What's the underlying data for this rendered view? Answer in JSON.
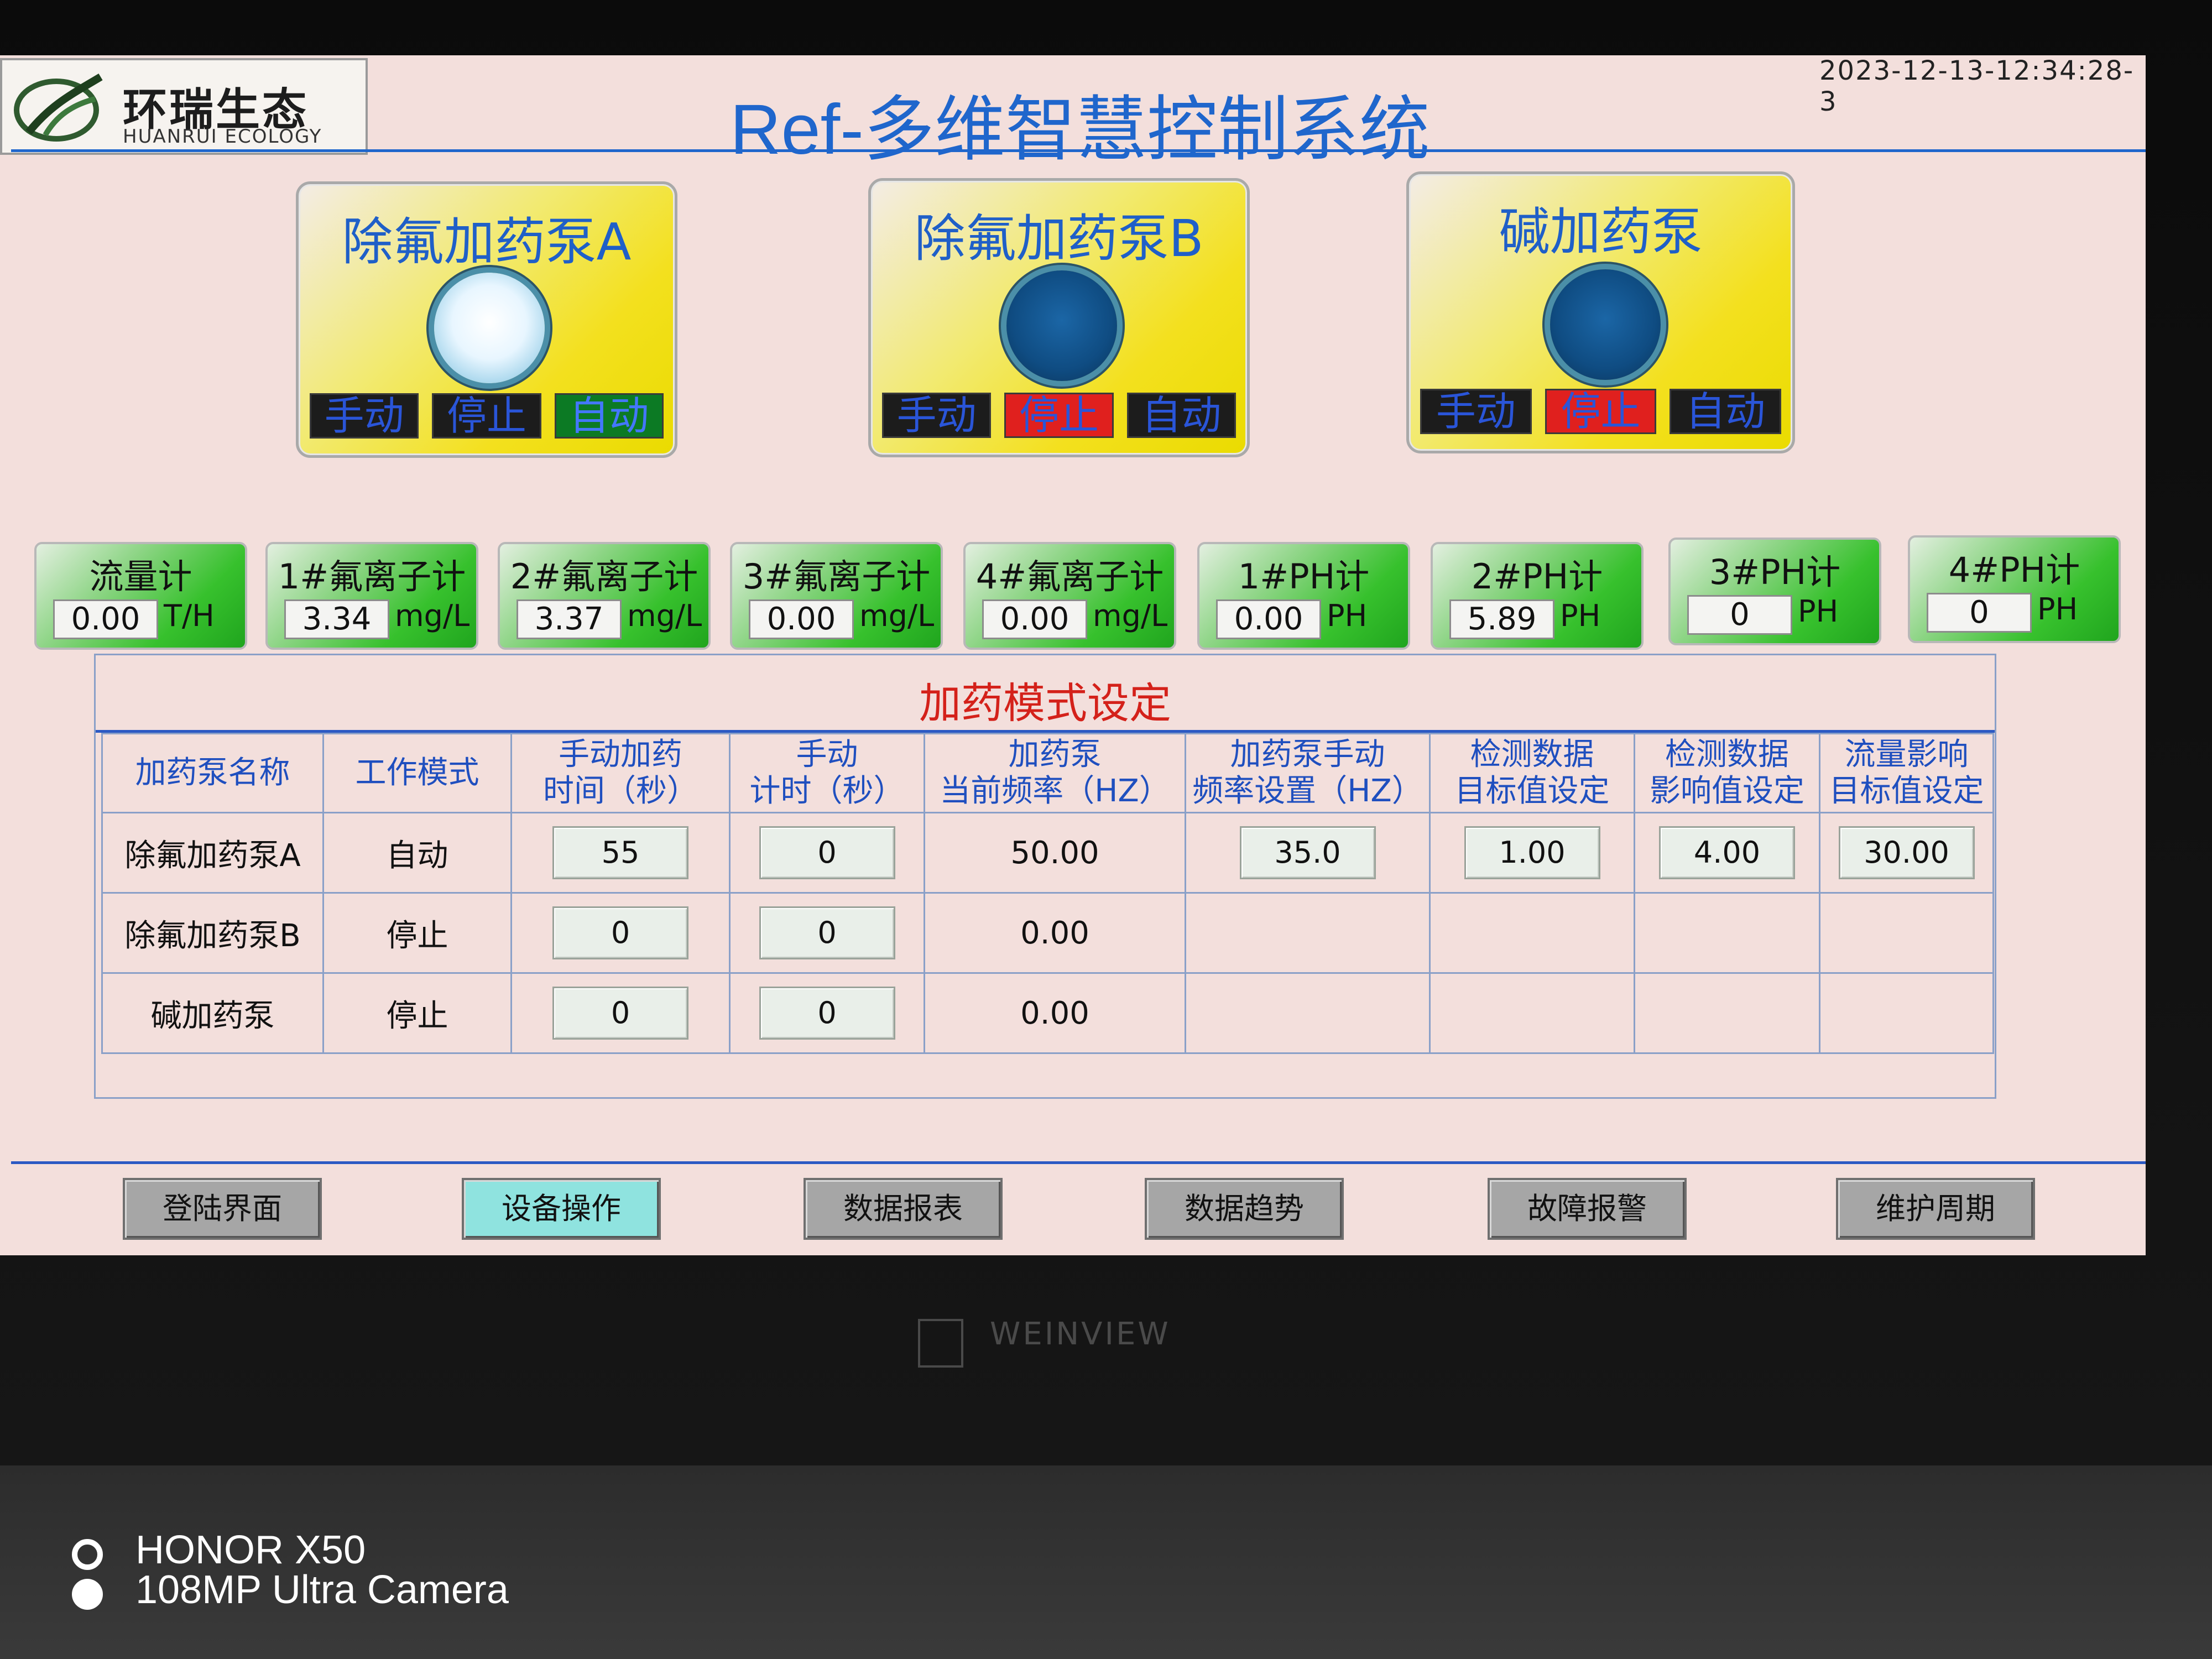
{
  "header": {
    "logo_cn": "环瑞生态",
    "logo_en": "HUANRUI ECOLOGY",
    "title": "Ref-多维智慧控制系统",
    "datetime": "2023-12-13-12:34:28-3"
  },
  "pumps": [
    {
      "title": "除氟加药泵A",
      "lamp": "on",
      "buttons": [
        "手动",
        "停止",
        "自动"
      ],
      "active": "自动"
    },
    {
      "title": "除氟加药泵B",
      "lamp": "off",
      "buttons": [
        "手动",
        "停止",
        "自动"
      ],
      "active": "停止"
    },
    {
      "title": "碱加药泵",
      "lamp": "off",
      "buttons": [
        "手动",
        "停止",
        "自动"
      ],
      "active": "停止"
    }
  ],
  "meters": [
    {
      "name": "流量计",
      "value": "0.00",
      "unit": "T/H"
    },
    {
      "name": "1#氟离子计",
      "value": "3.34",
      "unit": "mg/L"
    },
    {
      "name": "2#氟离子计",
      "value": "3.37",
      "unit": "mg/L"
    },
    {
      "name": "3#氟离子计",
      "value": "0.00",
      "unit": "mg/L"
    },
    {
      "name": "4#氟离子计",
      "value": "0.00",
      "unit": "mg/L"
    },
    {
      "name": "1#PH计",
      "value": "0.00",
      "unit": "PH"
    },
    {
      "name": "2#PH计",
      "value": "5.89",
      "unit": "PH"
    },
    {
      "name": "3#PH计",
      "value": "0",
      "unit": "PH"
    },
    {
      "name": "4#PH计",
      "value": "0",
      "unit": "PH"
    }
  ],
  "table": {
    "title": "加药模式设定",
    "headers": [
      [
        "加药泵名称",
        ""
      ],
      [
        "工作模式",
        ""
      ],
      [
        "手动加药",
        "时间（秒）"
      ],
      [
        "手动",
        "计时（秒）"
      ],
      [
        "加药泵",
        "当前频率（HZ）"
      ],
      [
        "加药泵手动",
        "频率设置（HZ）"
      ],
      [
        "检测数据",
        "目标值设定"
      ],
      [
        "检测数据",
        "影响值设定"
      ],
      [
        "流量影响",
        "目标值设定"
      ]
    ],
    "rows": [
      {
        "name": "除氟加药泵A",
        "mode": "自动",
        "manual_time": "55",
        "manual_timer": "0",
        "freq": "50.00",
        "freq_set": "35.0",
        "target": "1.00",
        "influence": "4.00",
        "flow_target": "30.00"
      },
      {
        "name": "除氟加药泵B",
        "mode": "停止",
        "manual_time": "0",
        "manual_timer": "0",
        "freq": "0.00"
      },
      {
        "name": "碱加药泵",
        "mode": "停止",
        "manual_time": "0",
        "manual_timer": "0",
        "freq": "0.00"
      }
    ]
  },
  "nav": [
    "登陆界面",
    "设备操作",
    "数据报表",
    "数据趋势",
    "故障报警",
    "维护周期"
  ],
  "nav_active": "设备操作",
  "bezel_brand": "WEINVIEW",
  "watermark": {
    "line1": "HONOR X50",
    "line2": "108MP Ultra Camera"
  },
  "colors": {
    "title_blue": "#1f66cc",
    "auto_green": "#20a020",
    "alarm_red": "#e0201e",
    "panel_yellow": "#f3e01e",
    "meter_green": "#37c12d"
  }
}
